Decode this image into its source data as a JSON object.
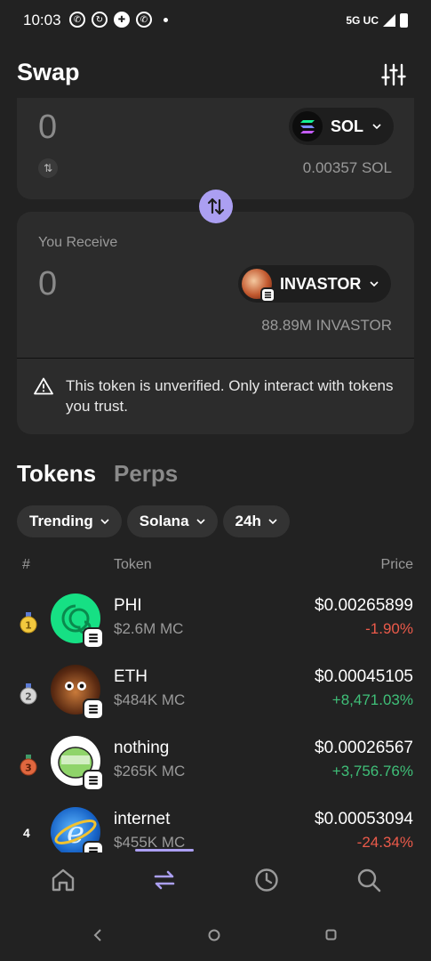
{
  "status_bar": {
    "time": "10:03",
    "network": "5G UC"
  },
  "header": {
    "title": "Swap"
  },
  "sell": {
    "amount": "0",
    "token": "SOL",
    "balance": "0.00357 SOL"
  },
  "receive": {
    "label": "You Receive",
    "amount": "0",
    "token": "INVASTOR",
    "balance": "88.89M INVASTOR",
    "warning": "This token is unverified. Only interact with tokens you trust."
  },
  "tabs": {
    "tokens": "Tokens",
    "perps": "Perps"
  },
  "filters": {
    "sort": "Trending",
    "chain": "Solana",
    "period": "24h"
  },
  "columns": {
    "rank": "#",
    "token": "Token",
    "price": "Price"
  },
  "tokens": [
    {
      "rank": "1",
      "name": "PHI",
      "mc": "$2.6M MC",
      "price": "$0.00265899",
      "change": "-1.90%",
      "direction": "neg"
    },
    {
      "rank": "2",
      "name": "ETH",
      "mc": "$484K MC",
      "price": "$0.00045105",
      "change": "+8,471.03%",
      "direction": "pos"
    },
    {
      "rank": "3",
      "name": "nothing",
      "mc": "$265K MC",
      "price": "$0.00026567",
      "change": "+3,756.76%",
      "direction": "pos"
    },
    {
      "rank": "4",
      "name": "internet",
      "mc": "$455K MC",
      "price": "$0.00053094",
      "change": "-24.34%",
      "direction": "neg"
    }
  ],
  "colors": {
    "accent": "#ab9ff2",
    "background": "#222222",
    "card": "#2c2c2c",
    "positive": "#3fbf78",
    "negative": "#eb5a4a"
  },
  "icons": {
    "settings": "sliders-icon",
    "swap_direction": "arrows-updown-icon",
    "warning": "warning-triangle-icon",
    "nav": [
      "home-icon",
      "swap-icon",
      "history-icon",
      "search-icon"
    ]
  }
}
